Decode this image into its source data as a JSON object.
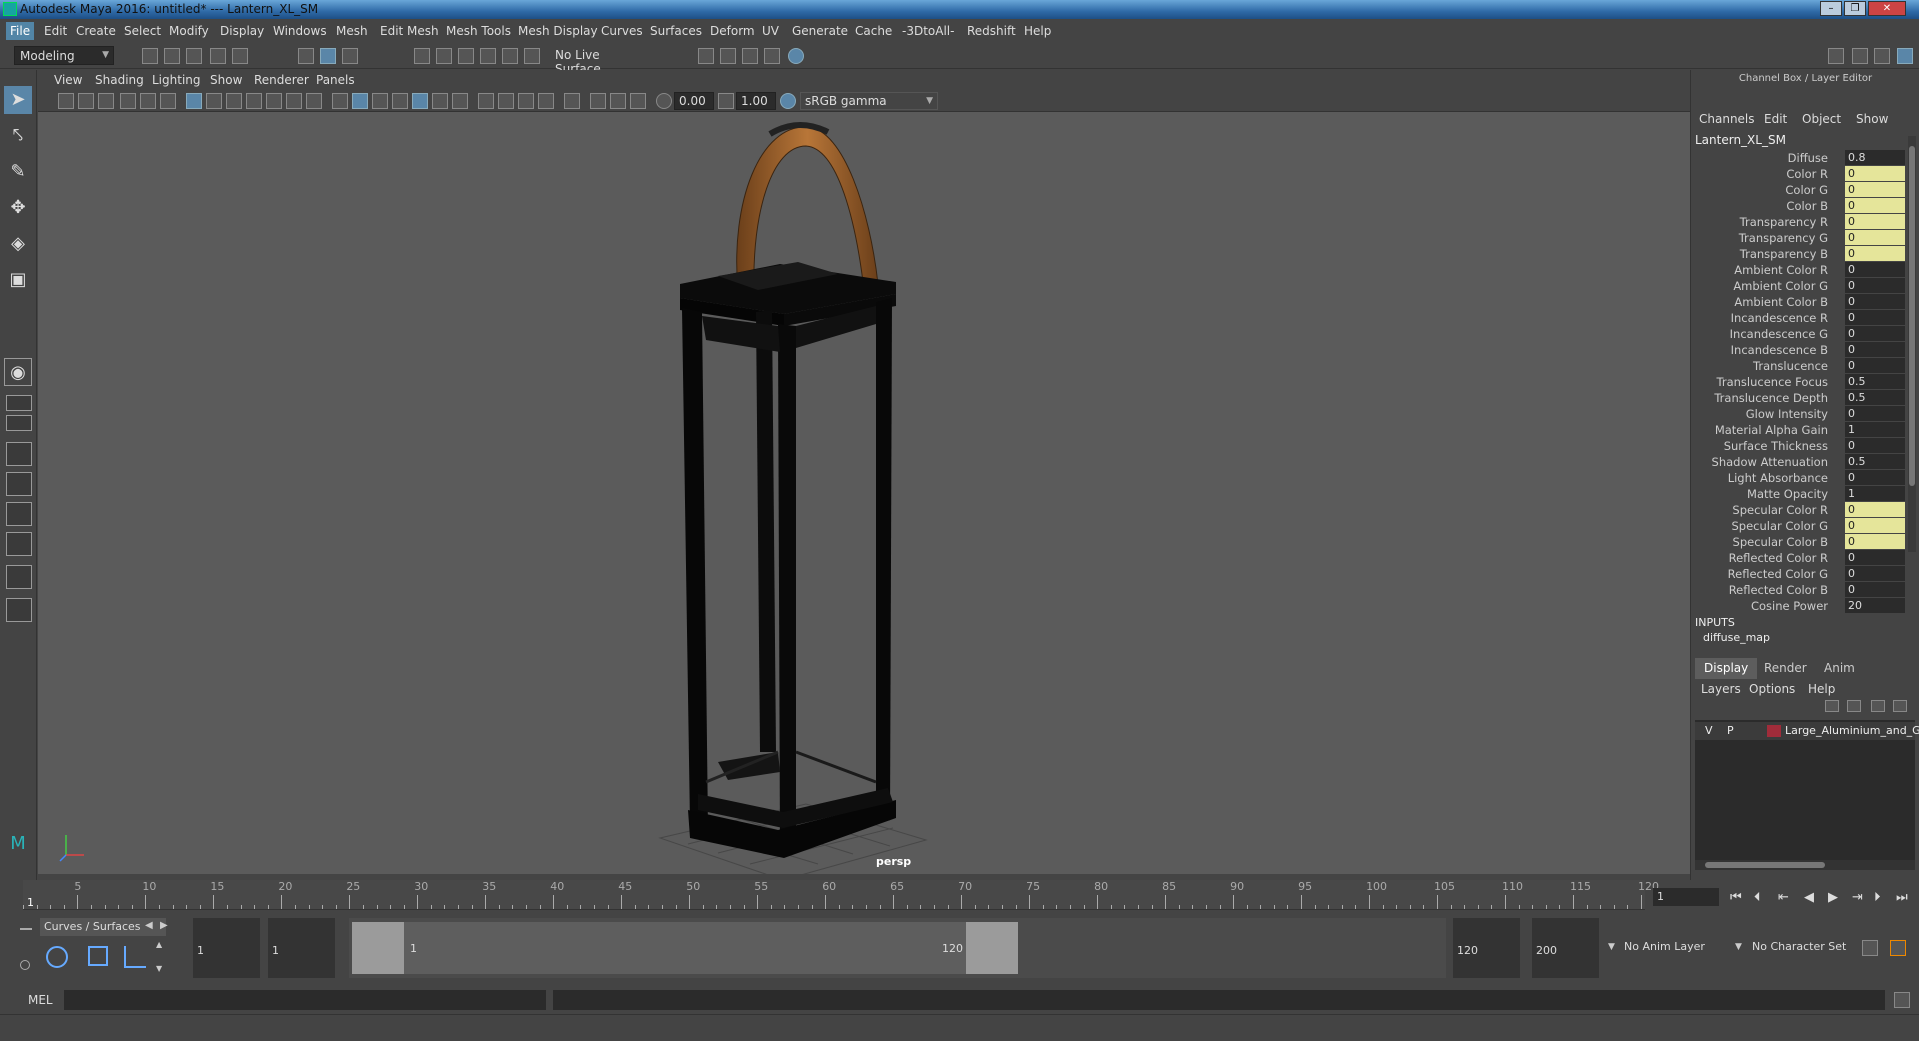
{
  "window": {
    "title": "Autodesk Maya 2016: untitled*   ---   Lantern_XL_SM",
    "min": "–",
    "max": "❐",
    "close": "✕"
  },
  "menubar": [
    "File",
    "Edit",
    "Create",
    "Select",
    "Modify",
    "Display",
    "Windows",
    "Mesh",
    "Edit Mesh",
    "Mesh Tools",
    "Mesh Display",
    "Curves",
    "Surfaces",
    "Deform",
    "UV",
    "Generate",
    "Cache",
    "-3DtoAll-",
    "Redshift",
    "Help"
  ],
  "status": {
    "menuset": "Modeling",
    "live_surface": "No Live Surface"
  },
  "panel_menu": [
    "View",
    "Shading",
    "Lighting",
    "Show",
    "Renderer",
    "Panels"
  ],
  "view_toolbar": {
    "exposure": "0.00",
    "gamma": "1.00",
    "colorspace": "sRGB gamma"
  },
  "viewport": {
    "camera": "persp"
  },
  "channel_box": {
    "panel_title": "Channel Box / Layer Editor",
    "menus": [
      "Channels",
      "Edit",
      "Object",
      "Show"
    ],
    "object_name": "Lantern_XL_SM",
    "attributes": [
      {
        "label": "Diffuse",
        "value": "0.8",
        "keyed": false
      },
      {
        "label": "Color R",
        "value": "0",
        "keyed": true
      },
      {
        "label": "Color G",
        "value": "0",
        "keyed": true
      },
      {
        "label": "Color B",
        "value": "0",
        "keyed": true
      },
      {
        "label": "Transparency R",
        "value": "0",
        "keyed": true
      },
      {
        "label": "Transparency G",
        "value": "0",
        "keyed": true
      },
      {
        "label": "Transparency B",
        "value": "0",
        "keyed": true
      },
      {
        "label": "Ambient Color R",
        "value": "0",
        "keyed": false
      },
      {
        "label": "Ambient Color G",
        "value": "0",
        "keyed": false
      },
      {
        "label": "Ambient Color B",
        "value": "0",
        "keyed": false
      },
      {
        "label": "Incandescence R",
        "value": "0",
        "keyed": false
      },
      {
        "label": "Incandescence G",
        "value": "0",
        "keyed": false
      },
      {
        "label": "Incandescence B",
        "value": "0",
        "keyed": false
      },
      {
        "label": "Translucence",
        "value": "0",
        "keyed": false
      },
      {
        "label": "Translucence Focus",
        "value": "0.5",
        "keyed": false
      },
      {
        "label": "Translucence Depth",
        "value": "0.5",
        "keyed": false
      },
      {
        "label": "Glow Intensity",
        "value": "0",
        "keyed": false
      },
      {
        "label": "Material Alpha Gain",
        "value": "1",
        "keyed": false
      },
      {
        "label": "Surface Thickness",
        "value": "0",
        "keyed": false
      },
      {
        "label": "Shadow Attenuation",
        "value": "0.5",
        "keyed": false
      },
      {
        "label": "Light Absorbance",
        "value": "0",
        "keyed": false
      },
      {
        "label": "Matte Opacity",
        "value": "1",
        "keyed": false
      },
      {
        "label": "Specular Color R",
        "value": "0",
        "keyed": true
      },
      {
        "label": "Specular Color G",
        "value": "0",
        "keyed": true
      },
      {
        "label": "Specular Color B",
        "value": "0",
        "keyed": true
      },
      {
        "label": "Reflected Color R",
        "value": "0",
        "keyed": false
      },
      {
        "label": "Reflected Color G",
        "value": "0",
        "keyed": false
      },
      {
        "label": "Reflected Color B",
        "value": "0",
        "keyed": false
      },
      {
        "label": "Cosine Power",
        "value": "20",
        "keyed": false
      }
    ],
    "inputs_header": "INPUTS",
    "inputs_item": "diffuse_map"
  },
  "layer_editor": {
    "tabs": [
      "Display",
      "Render",
      "Anim"
    ],
    "menus": [
      "Layers",
      "Options",
      "Help"
    ],
    "layer": {
      "v": "V",
      "p": "P",
      "name": "Large_Aluminium_and_Gl",
      "color": "#a02c3a"
    }
  },
  "timeline": {
    "ticks": [
      5,
      10,
      15,
      20,
      25,
      30,
      35,
      40,
      45,
      50,
      55,
      60,
      65,
      70,
      75,
      80,
      85,
      90,
      95,
      100,
      105,
      110,
      115,
      120
    ],
    "start_label": "1",
    "current_frame": "1"
  },
  "range": {
    "tab_label": "Curves / Surfaces",
    "start": "1",
    "playback_start": "1",
    "range_start_label": "1",
    "range_end_label": "120",
    "playback_end": "120",
    "end": "200",
    "anim_layer": "No Anim Layer",
    "character_set": "No Character Set"
  },
  "cmdline": {
    "lang": "MEL"
  }
}
